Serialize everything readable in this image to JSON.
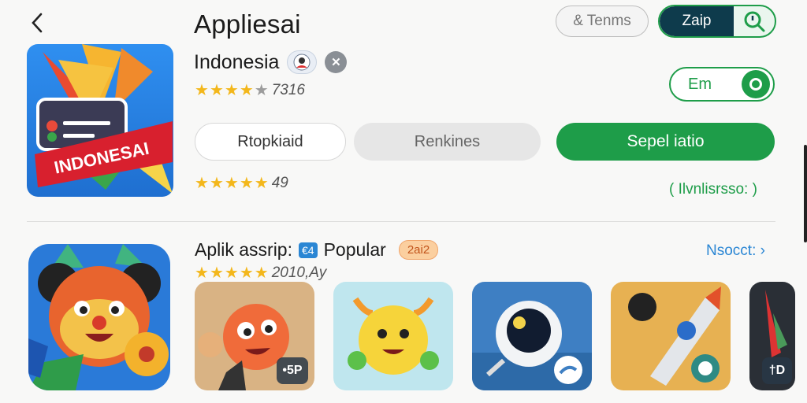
{
  "header": {
    "title": "Appliesai",
    "subtitle": "Indonesia",
    "close_glyph": "✕"
  },
  "main_icon": {
    "banner_text": "INDONESAI"
  },
  "ratings": {
    "row1_stars": 4,
    "row1_text": "7316",
    "row2_stars": 5,
    "row2_text": "49",
    "row3_stars": 5,
    "row3_text": "2010,Ay"
  },
  "top_actions": {
    "terms_label": "& Tenms",
    "seg_label": "Zaip"
  },
  "toggle": {
    "label": "Em"
  },
  "buttons": {
    "outline": "Rtopkiaid",
    "gray": "Renkines",
    "green": "Sepel iatio"
  },
  "see_more": "( Ilvnlisrsso: )",
  "section": {
    "title": "Aplik assrip:",
    "tag_blue": "€4",
    "popular": "Popular",
    "tag_orange": "2ai2",
    "link": "Nsocct: "
  },
  "thumbs": [
    {
      "badge": "•5P",
      "bg": "#d9b384"
    },
    {
      "badge": "",
      "bg": "#bfe6ee"
    },
    {
      "badge": "",
      "bg": "#3e7fc3"
    },
    {
      "badge": "",
      "bg": "#e7b152"
    },
    {
      "badge": "†D",
      "bg": "#2a2f36"
    }
  ],
  "colors": {
    "accent_green": "#1e9d49",
    "star": "#f3b71b",
    "link_blue": "#2a86d4",
    "dark_teal": "#0e3b4c"
  }
}
